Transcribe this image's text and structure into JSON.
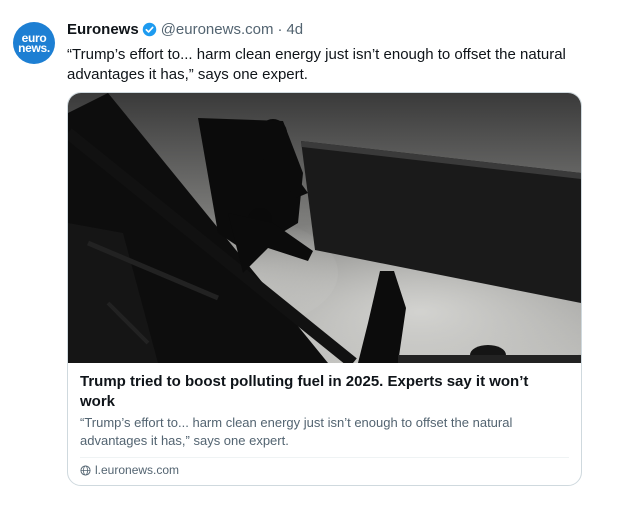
{
  "author": {
    "name": "Euronews",
    "handle": "@euronews.com",
    "separator": "·",
    "time": "4d",
    "avatar_line1": "euro",
    "avatar_line2": "news."
  },
  "post": {
    "text": "“Trump’s effort to... harm clean energy just isn’t enough to offset the natural advantages it has,” says one expert."
  },
  "card": {
    "title": "Trump tried to boost polluting fuel in 2025. Experts say it won’t work",
    "description": "“Trump’s effort to... harm clean energy just isn’t enough to offset the natural advantages it has,” says one expert.",
    "domain": "l.euronews.com"
  },
  "colors": {
    "avatar": "#1d7fd3",
    "verified": "#1d9bf0",
    "muted_text": "#536471",
    "border": "#cfd9de"
  }
}
